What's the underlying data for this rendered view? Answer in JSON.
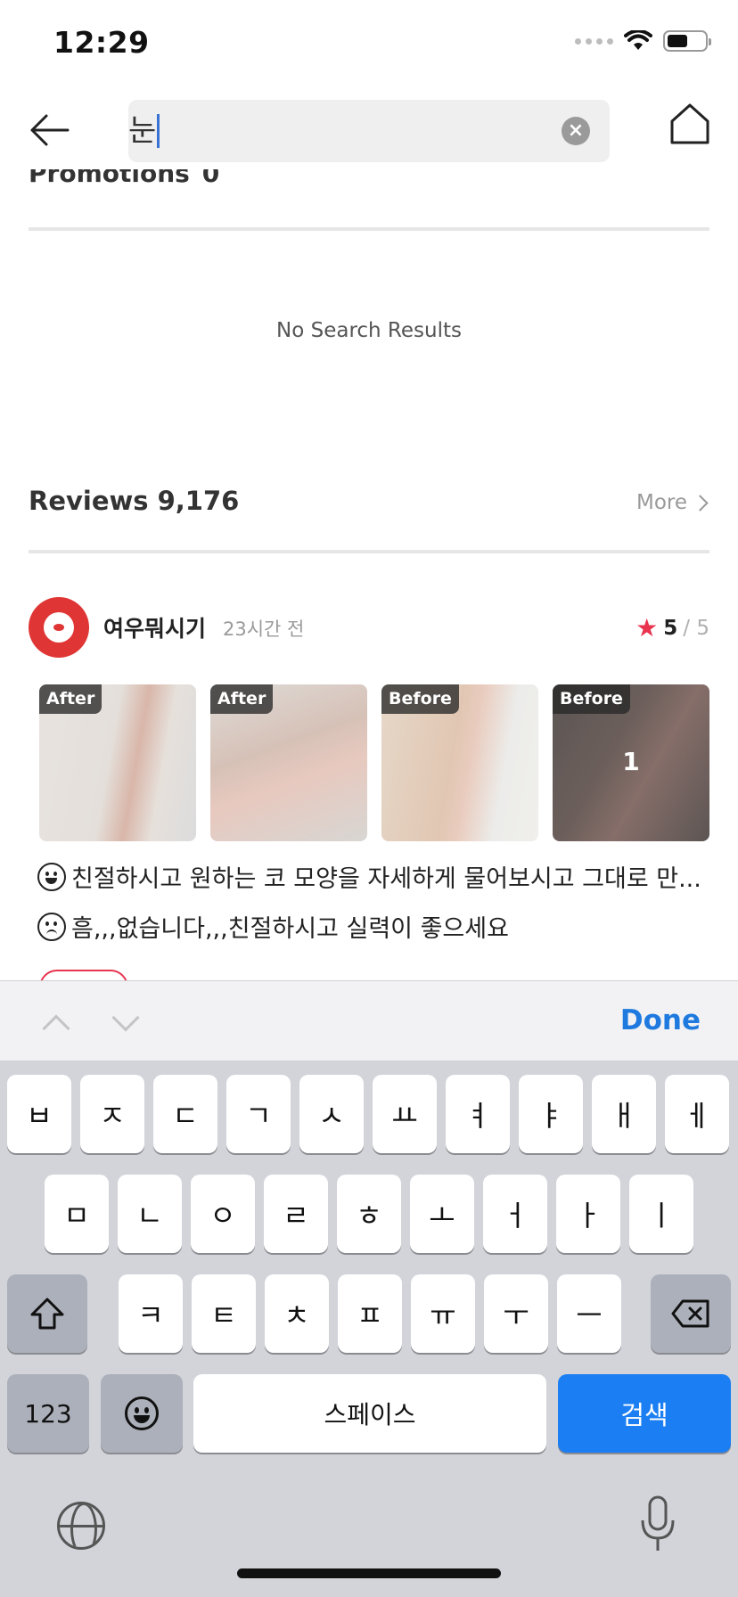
{
  "status_bar": {
    "time": "12:29"
  },
  "search": {
    "query": "눈",
    "clear_icon": "close-circle-icon"
  },
  "promotions": {
    "label": "Promotions",
    "count": "0",
    "empty_message": "No Search Results"
  },
  "reviews": {
    "label": "Reviews",
    "count": "9,176",
    "more_label": "More",
    "items": [
      {
        "reviewer": "여우뭐시기",
        "time": "23시간 전",
        "rating": "5",
        "rating_max": "/ 5",
        "photos": [
          {
            "tag": "After"
          },
          {
            "tag": "After"
          },
          {
            "tag": "Before"
          },
          {
            "tag": "Before",
            "more_count": "1"
          }
        ],
        "positive": "친절하시고 원하는 코 모양을 자세하게 물어보시고 그대로 만...",
        "negative": "흠,,,없습니다,,,친절하시고 실력이 좋으세요"
      }
    ]
  },
  "keyboard": {
    "done_label": "Done",
    "row1": [
      "ㅂ",
      "ㅈ",
      "ㄷ",
      "ㄱ",
      "ㅅ",
      "ㅛ",
      "ㅕ",
      "ㅑ",
      "ㅐ",
      "ㅔ"
    ],
    "row2": [
      "ㅁ",
      "ㄴ",
      "ㅇ",
      "ㄹ",
      "ㅎ",
      "ㅗ",
      "ㅓ",
      "ㅏ",
      "ㅣ"
    ],
    "row3": [
      "ㅋ",
      "ㅌ",
      "ㅊ",
      "ㅍ",
      "ㅠ",
      "ㅜ",
      "ㅡ"
    ],
    "numbers_label": "123",
    "space_label": "스페이스",
    "search_label": "검색"
  },
  "colors": {
    "accent": "#1b7ef2",
    "star": "#e8344e",
    "avatar": "#e03535"
  }
}
